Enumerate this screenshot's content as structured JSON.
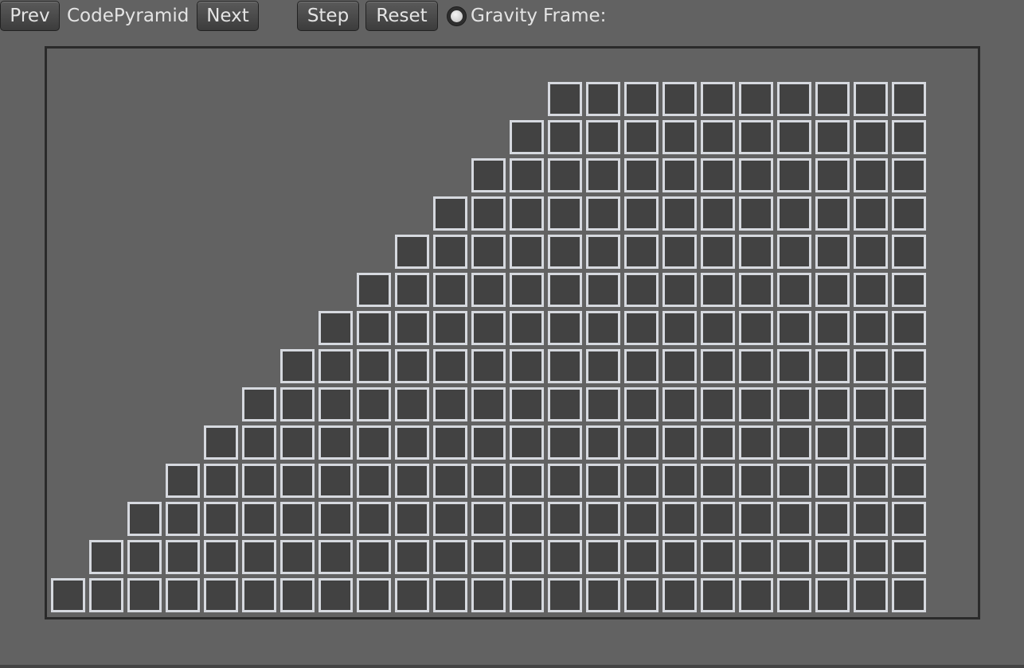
{
  "toolbar": {
    "prev_label": "Prev",
    "demo_name": "CodePyramid",
    "next_label": "Next",
    "step_label": "Step",
    "reset_label": "Reset",
    "gravity_label": "Gravity",
    "gravity_enabled": true,
    "frame_label": "Frame:",
    "frame_value": ""
  },
  "scene": {
    "pyramid_rows": 14,
    "box_fill_color": "#424242",
    "box_outline_color": "#d6d9df",
    "background_color": "#626262"
  }
}
